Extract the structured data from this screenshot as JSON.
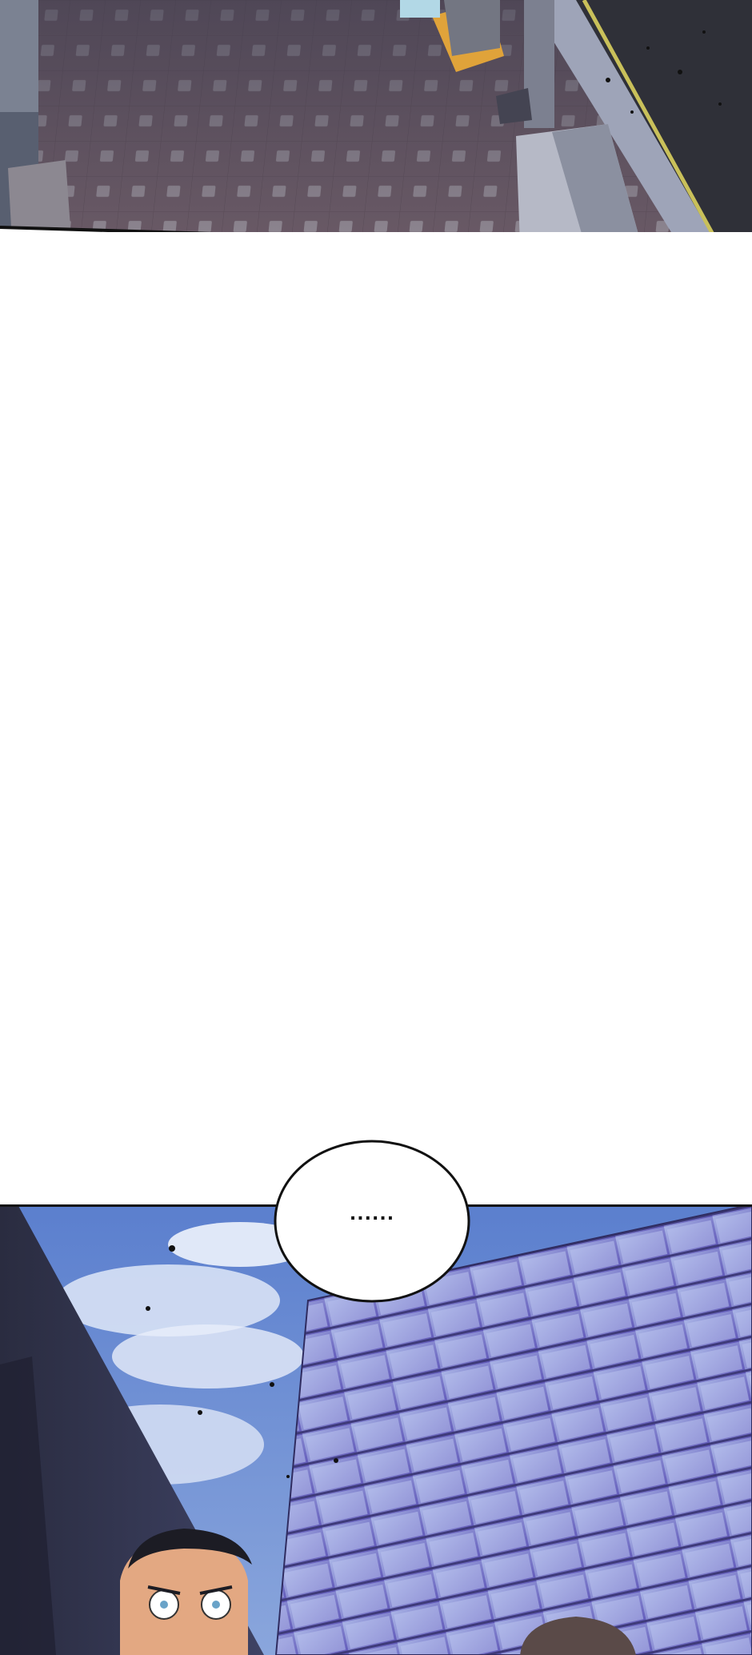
{
  "bubble": {
    "text": "......"
  }
}
